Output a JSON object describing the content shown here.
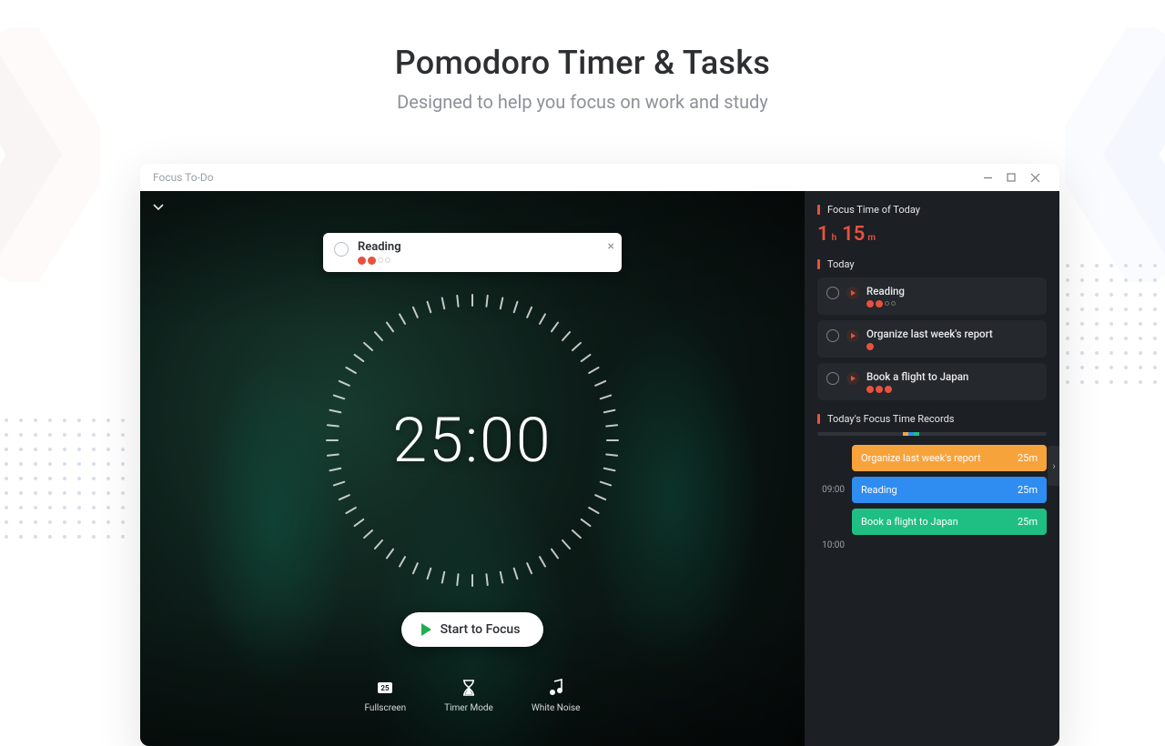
{
  "hero": {
    "title": "Pomodoro Timer & Tasks",
    "subtitle": "Designed to help you focus on work and study"
  },
  "window": {
    "title": "Focus To-Do"
  },
  "current_task": {
    "title": "Reading",
    "pomodoros_done": 2,
    "pomodoros_total": 4
  },
  "timer": {
    "display": "25:00"
  },
  "start": {
    "label": "Start to Focus"
  },
  "tools": {
    "fullscreen": "Fullscreen",
    "timer_mode": "Timer Mode",
    "white_noise": "White Noise"
  },
  "sidebar": {
    "focus_time": {
      "heading": "Focus Time of Today",
      "hours": "1",
      "h_unit": "h",
      "minutes": "15",
      "m_unit": "m"
    },
    "today": {
      "heading": "Today",
      "tasks": [
        {
          "name": "Reading",
          "done": 2,
          "total": 4
        },
        {
          "name": "Organize last week's report",
          "done": 1,
          "total": 1
        },
        {
          "name": "Book a flight to Japan",
          "done": 3,
          "total": 3
        }
      ]
    },
    "records": {
      "heading": "Today's Focus Time Records",
      "scale_colors": [
        "#f7a33c",
        "#2f8cf0",
        "#1fbf84"
      ],
      "rows": [
        {
          "time": "",
          "label": "Organize last week's report",
          "duration": "25m",
          "color": "orange"
        },
        {
          "time": "09:00",
          "label": "Reading",
          "duration": "25m",
          "color": "blue"
        },
        {
          "time": "",
          "label": "Book a flight to Japan",
          "duration": "25m",
          "color": "green"
        },
        {
          "time": "10:00",
          "label": "",
          "duration": "",
          "color": ""
        }
      ]
    }
  }
}
